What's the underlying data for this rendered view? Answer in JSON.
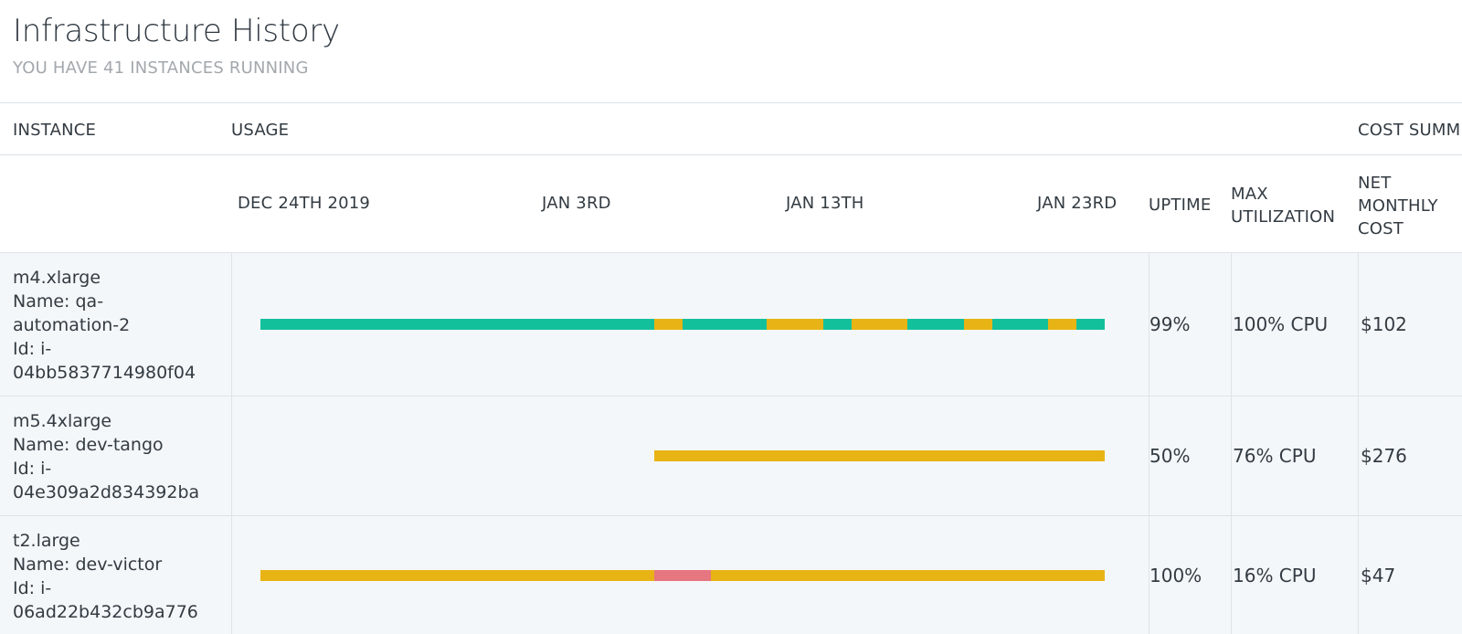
{
  "header": {
    "title": "Infrastructure History",
    "subtitle": "YOU HAVE 41 INSTANCES RUNNING"
  },
  "columns": {
    "instance": "INSTANCE",
    "usage": "USAGE",
    "cost_summary": "COST SUMM"
  },
  "timeline": {
    "dates": [
      "DEC 24TH 2019",
      "JAN 3RD",
      "JAN 13TH",
      "JAN 23RD"
    ]
  },
  "sub_headers": {
    "uptime": "UPTIME",
    "max_util_line1": "MAX",
    "max_util_line2": "UTILIZATION",
    "cost_line1": "NET",
    "cost_line2": "MONTHLY",
    "cost_line3": "COST"
  },
  "colors": {
    "teal": "#13c09c",
    "amber": "#e8b415",
    "pink": "#e67680"
  },
  "rows": [
    {
      "instance_lines": [
        "m4.xlarge",
        "Name: qa-",
        "automation-2",
        "Id: i-",
        "04bb5837714980f04"
      ],
      "uptime": "99%",
      "max_utilization": "100% CPU",
      "net_monthly_cost": "$102",
      "segments": [
        {
          "status": "teal",
          "from": 0.0,
          "to": 0.4667
        },
        {
          "status": "amber",
          "from": 0.4667,
          "to": 0.5
        },
        {
          "status": "teal",
          "from": 0.5,
          "to": 0.6
        },
        {
          "status": "amber",
          "from": 0.6,
          "to": 0.6667
        },
        {
          "status": "teal",
          "from": 0.6667,
          "to": 0.7
        },
        {
          "status": "amber",
          "from": 0.7,
          "to": 0.7667
        },
        {
          "status": "teal",
          "from": 0.7667,
          "to": 0.8333
        },
        {
          "status": "amber",
          "from": 0.8333,
          "to": 0.8667
        },
        {
          "status": "teal",
          "from": 0.8667,
          "to": 0.9333
        },
        {
          "status": "amber",
          "from": 0.9333,
          "to": 0.9667
        },
        {
          "status": "teal",
          "from": 0.9667,
          "to": 1.0
        }
      ]
    },
    {
      "instance_lines": [
        "m5.4xlarge",
        "Name: dev-tango",
        "Id: i-",
        "04e309a2d834392ba"
      ],
      "uptime": "50%",
      "max_utilization": "76% CPU",
      "net_monthly_cost": "$276",
      "segments": [
        {
          "status": "amber",
          "from": 0.4667,
          "to": 1.0
        }
      ]
    },
    {
      "instance_lines": [
        "t2.large",
        "Name: dev-victor",
        "Id: i-",
        "06ad22b432cb9a776"
      ],
      "uptime": "100%",
      "max_utilization": "16% CPU",
      "net_monthly_cost": "$47",
      "segments": [
        {
          "status": "amber",
          "from": 0.0,
          "to": 0.4667
        },
        {
          "status": "pink",
          "from": 0.4667,
          "to": 0.5333
        },
        {
          "status": "amber",
          "from": 0.5333,
          "to": 1.0
        }
      ]
    }
  ]
}
